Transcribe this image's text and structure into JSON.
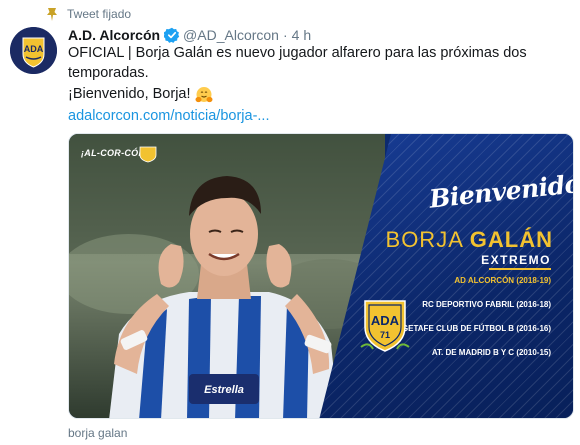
{
  "pinned": {
    "label": "Tweet fijado",
    "icon": "pin-icon"
  },
  "account": {
    "display_name": "A.D. Alcorcón",
    "handle": "@AD_Alcorcon",
    "timestamp": "4 h",
    "avatar_icon": "club-crest-avatar",
    "verified_icon": "verified-badge-icon"
  },
  "tweet": {
    "line1": "OFICIAL | Borja Galán es nuevo jugador alfarero para las próximas dos",
    "line2": "temporadas.",
    "line3": "¡Bienvenido, Borja!",
    "emoji": "hugging-face-emoji",
    "link": "adalcorcon.com/noticia/borja-..."
  },
  "media": {
    "hashtag": "¡AL-COR-CÓN!",
    "welcome": "Bienvenido",
    "first_name": "BORJA",
    "surname": "GALÁN",
    "position": "EXTREMO",
    "history": [
      {
        "club": "AD ALCORCÓN",
        "years": "(2018-19)",
        "current": true
      },
      {
        "club": "RC DEPORTIVO FABRIL",
        "years": "(2016-18)",
        "current": false
      },
      {
        "club": "GETAFE CLUB DE FÚTBOL B",
        "years": "(2016-16)",
        "current": false
      },
      {
        "club": "AT. DE MADRID B Y C",
        "years": "(2010-15)",
        "current": false
      }
    ],
    "crest_text": "ADA",
    "crest_year": "71"
  },
  "caption": "borja galan",
  "colors": {
    "accent_link": "#1b95e0",
    "secondary_text": "#657786",
    "club_blue": "#0b2668",
    "club_yellow": "#f2c230",
    "pin": "#c9a227"
  }
}
